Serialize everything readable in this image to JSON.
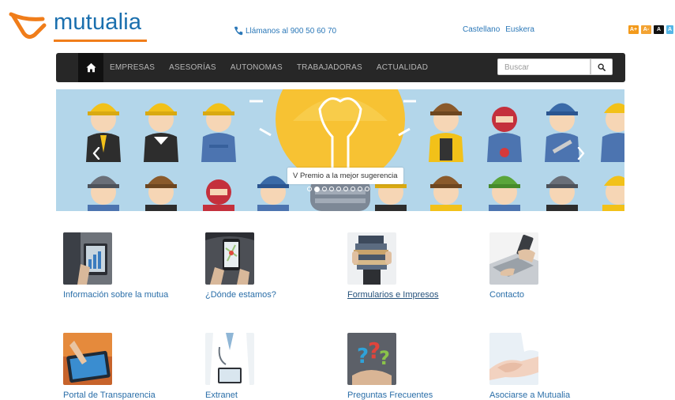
{
  "brand": {
    "name": "mutualia",
    "accent": "#f07d1a",
    "primary": "#1a6fae"
  },
  "header": {
    "phone_icon": "phone-icon",
    "phone_text": "Llámanos al 900 50 60 70",
    "languages": [
      "Castellano",
      "Euskera"
    ],
    "font_controls": [
      "A+",
      "A-",
      "A",
      "A"
    ]
  },
  "nav": {
    "home_icon": "home-icon",
    "items": [
      "EMPRESAS",
      "ASESORÍAS",
      "AUTONOMAS",
      "TRABAJADORAS",
      "ACTUALIDAD"
    ],
    "search_placeholder": "Buscar",
    "search_icon": "search-icon"
  },
  "banner": {
    "caption": "V Premio a la mejor sugerencia",
    "slide_count": 9,
    "active_slide": 2
  },
  "tiles": [
    {
      "label": "Información sobre la mutua",
      "icon": "tablet-business-image"
    },
    {
      "label": "¿Dónde estamos?",
      "icon": "map-phone-image"
    },
    {
      "label": "Formularios e Impresos",
      "icon": "binders-image"
    },
    {
      "label": "Contacto",
      "icon": "laptop-phone-image"
    },
    {
      "label": "Portal de Transparencia",
      "icon": "touchscreen-image"
    },
    {
      "label": "Extranet",
      "icon": "doctor-tablet-image"
    },
    {
      "label": "Preguntas Frecuentes",
      "icon": "question-marks-image"
    },
    {
      "label": "Asociarse a Mutualia",
      "icon": "handshake-image"
    }
  ]
}
